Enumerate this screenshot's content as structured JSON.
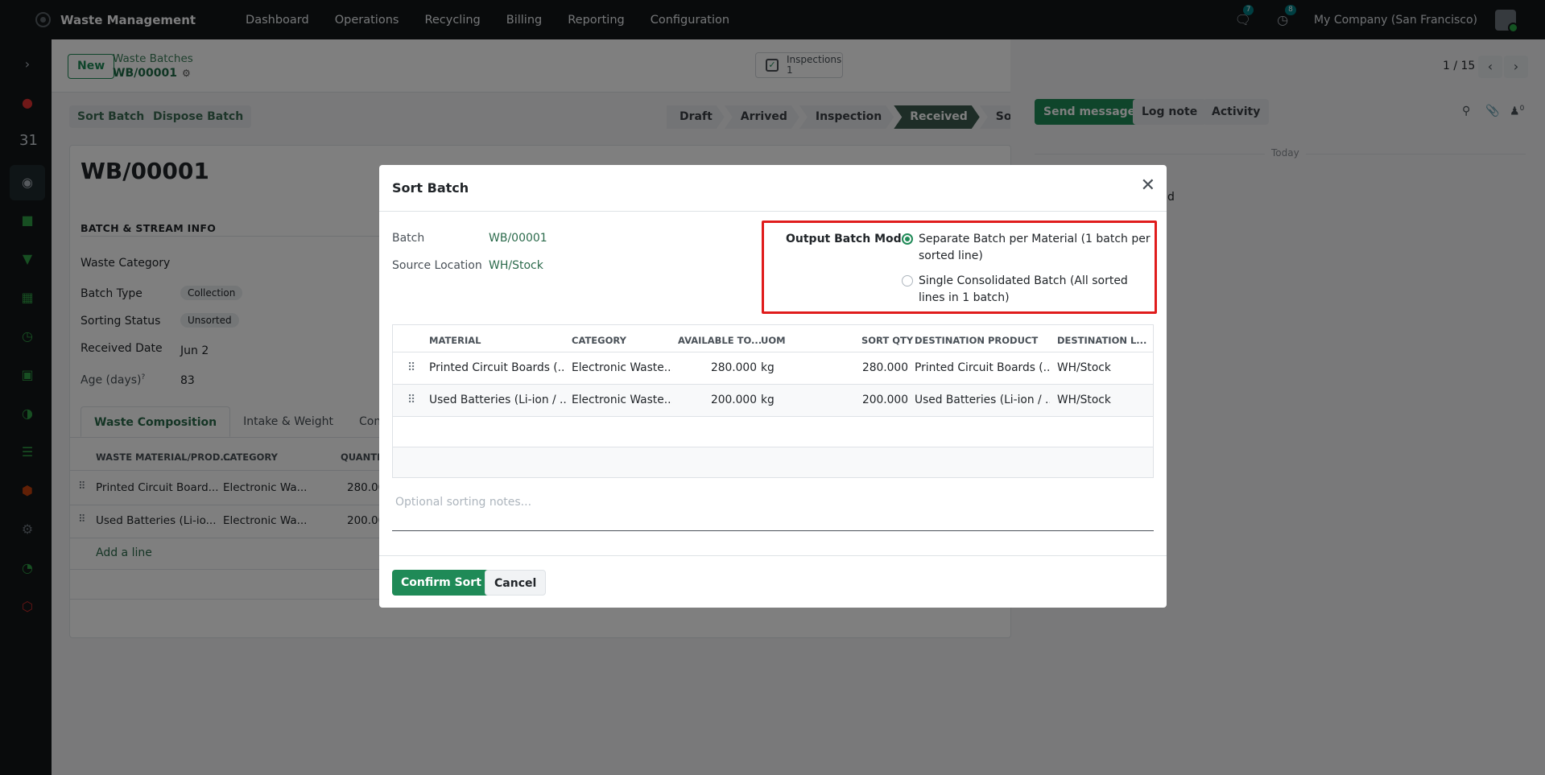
{
  "app": {
    "title": "Waste Management"
  },
  "menu": [
    "Dashboard",
    "Operations",
    "Recycling",
    "Billing",
    "Reporting",
    "Configuration"
  ],
  "topbar": {
    "chat_count": "7",
    "activity_count": "8",
    "company": "My Company (San Francisco)"
  },
  "control": {
    "new_label": "New",
    "breadcrumb_parent": "Waste Batches",
    "breadcrumb_current": "WB/00001",
    "inspections_label": "Inspections",
    "inspections_count": "1",
    "pager": "1 / 15"
  },
  "actions": {
    "sort_batch": "Sort Batch",
    "dispose_batch": "Dispose Batch"
  },
  "statusbar": [
    "Draft",
    "Arrived",
    "Inspection",
    "Received",
    "Sorting"
  ],
  "chatter": {
    "send": "Send message",
    "log": "Log note",
    "activity": "Activity",
    "today": "Today",
    "followers": "0",
    "partial": "d"
  },
  "form": {
    "title": "WB/00001",
    "section": "BATCH & STREAM INFO",
    "fields": {
      "waste_category": "Waste Category",
      "batch_type": "Batch Type",
      "batch_type_val": "Collection",
      "sorting_status": "Sorting Status",
      "sorting_status_val": "Unsorted",
      "received_date": "Received Date",
      "received_date_val": "Jun 2",
      "age": "Age (days)",
      "age_sup": "?",
      "age_val": "83"
    },
    "tabs": [
      "Waste Composition",
      "Intake & Weight",
      "Containe"
    ],
    "table": {
      "headers": [
        "WASTE MATERIAL/PROD...",
        "CATEGORY",
        "QUANTIT"
      ],
      "rows": [
        [
          "Printed Circuit Board...",
          "Electronic Wa...",
          "280.00"
        ],
        [
          "Used Batteries (Li-io...",
          "Electronic Wa...",
          "200.00"
        ]
      ],
      "add": "Add a line"
    }
  },
  "modal": {
    "title": "Sort Batch",
    "batch_label": "Batch",
    "batch_val": "WB/00001",
    "loc_label": "Source Location",
    "loc_val": "WH/Stock",
    "mode_label": "Output Batch Mode",
    "opt1": "Separate Batch per Material (1 batch per sorted line)",
    "opt2": "Single Consolidated Batch (All sorted lines in 1 batch)",
    "opt_selected": 1,
    "headers": [
      "MATERIAL",
      "CATEGORY",
      "AVAILABLE TO...",
      "UOM",
      "SORT QTY",
      "DESTINATION PRODUCT",
      "DESTINATION L..."
    ],
    "rows": [
      [
        "Printed Circuit Boards (...",
        "Electronic Waste...",
        "280.000",
        "kg",
        "280.000",
        "Printed Circuit Boards (...",
        "WH/Stock"
      ],
      [
        "Used Batteries (Li-ion / ...",
        "Electronic Waste...",
        "200.000",
        "kg",
        "200.000",
        "Used Batteries (Li-ion / ...",
        "WH/Stock"
      ]
    ],
    "notes_placeholder": "Optional sorting notes...",
    "confirm": "Confirm Sort",
    "cancel": "Cancel"
  },
  "colors": {
    "brand": "#1f8a57",
    "highlight": "#e01c1c",
    "topbar": "#121619"
  }
}
